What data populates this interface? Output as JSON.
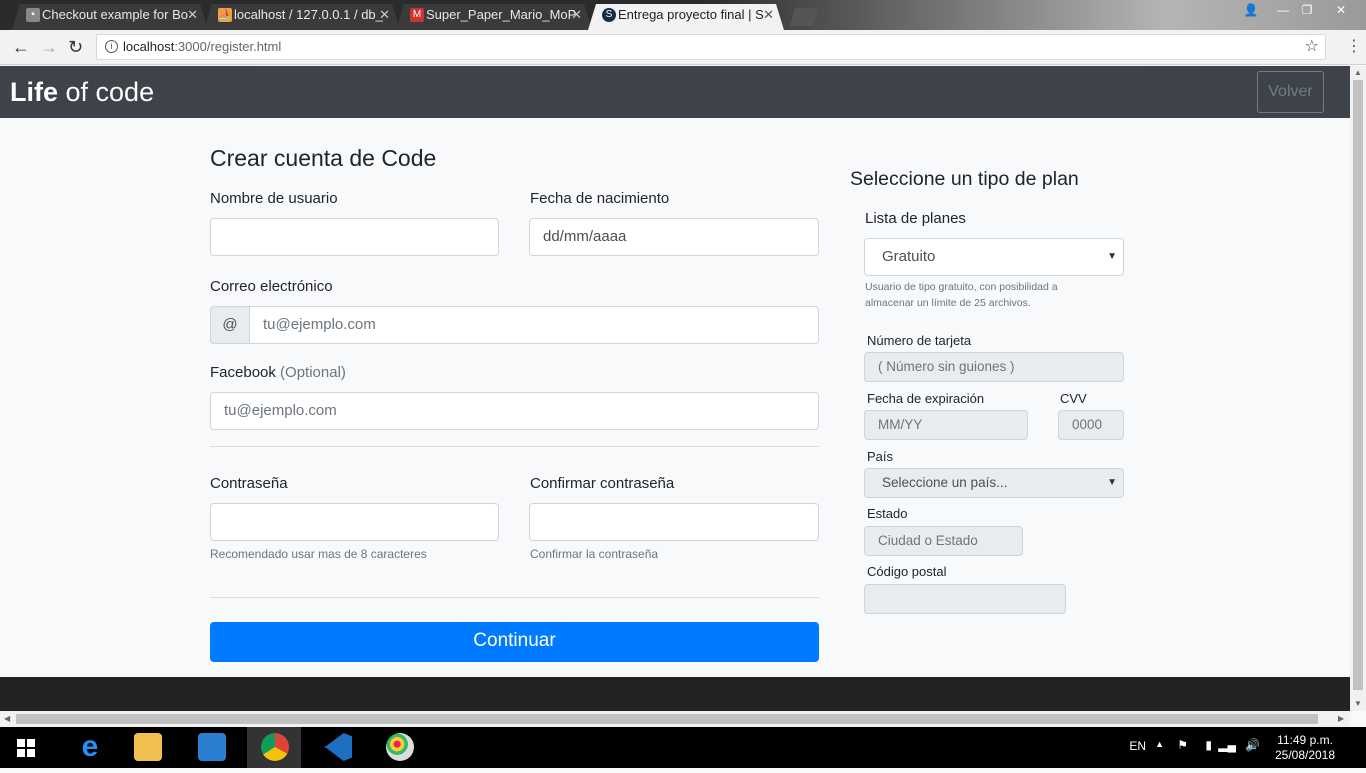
{
  "browser": {
    "tabs": [
      {
        "title": "Checkout example for Bo",
        "active": false
      },
      {
        "title": "localhost / 127.0.0.1 / db_",
        "active": false
      },
      {
        "title": "Super_Paper_Mario_MoP",
        "active": false
      },
      {
        "title": "Entrega proyecto final | S",
        "active": true
      }
    ],
    "url_host": "localhost",
    "url_path": ":3000/register.html"
  },
  "navbar": {
    "brand_bold": "Life",
    "brand_rest": " of code",
    "back_label": "Volver"
  },
  "form": {
    "title": "Crear cuenta de Code",
    "username_label": "Nombre de usuario",
    "birthdate_label": "Fecha de nacimiento",
    "birthdate_placeholder": "dd/mm/aaaa",
    "email_label": "Correo electrónico",
    "email_prefix": "@",
    "email_placeholder": "tu@ejemplo.com",
    "facebook_label": "Facebook",
    "facebook_optional": " (Optional)",
    "facebook_placeholder": "tu@ejemplo.com",
    "password_label": "Contraseña",
    "password_help": "Recomendado usar mas de 8 caracteres",
    "confirm_label": "Confirmar contraseña",
    "confirm_help": "Confirmar la contraseña",
    "continue_label": "Continuar"
  },
  "plan": {
    "title": "Seleccione un tipo de plan",
    "list_label": "Lista de planes",
    "selected_plan": "Gratuito",
    "plan_desc_line1": "Usuario de tipo gratuito, con posibilidad a",
    "plan_desc_line2": "almacenar un límite de 25 archivos.",
    "card_label": "Número de tarjeta",
    "card_placeholder": "( Número sin guiones )",
    "exp_label": "Fecha de expiración",
    "exp_placeholder": "MM/YY",
    "cvv_label": "CVV",
    "cvv_placeholder": "0000",
    "country_label": "País",
    "country_placeholder": "Seleccione un país...",
    "state_label": "Estado",
    "state_placeholder": "Ciudad o Estado",
    "zip_label": "Código postal"
  },
  "taskbar": {
    "language": "EN",
    "time": "11:49 p.m.",
    "date": "25/08/2018"
  },
  "colors": {
    "primary": "#007bff",
    "navbar": "#343a40"
  }
}
